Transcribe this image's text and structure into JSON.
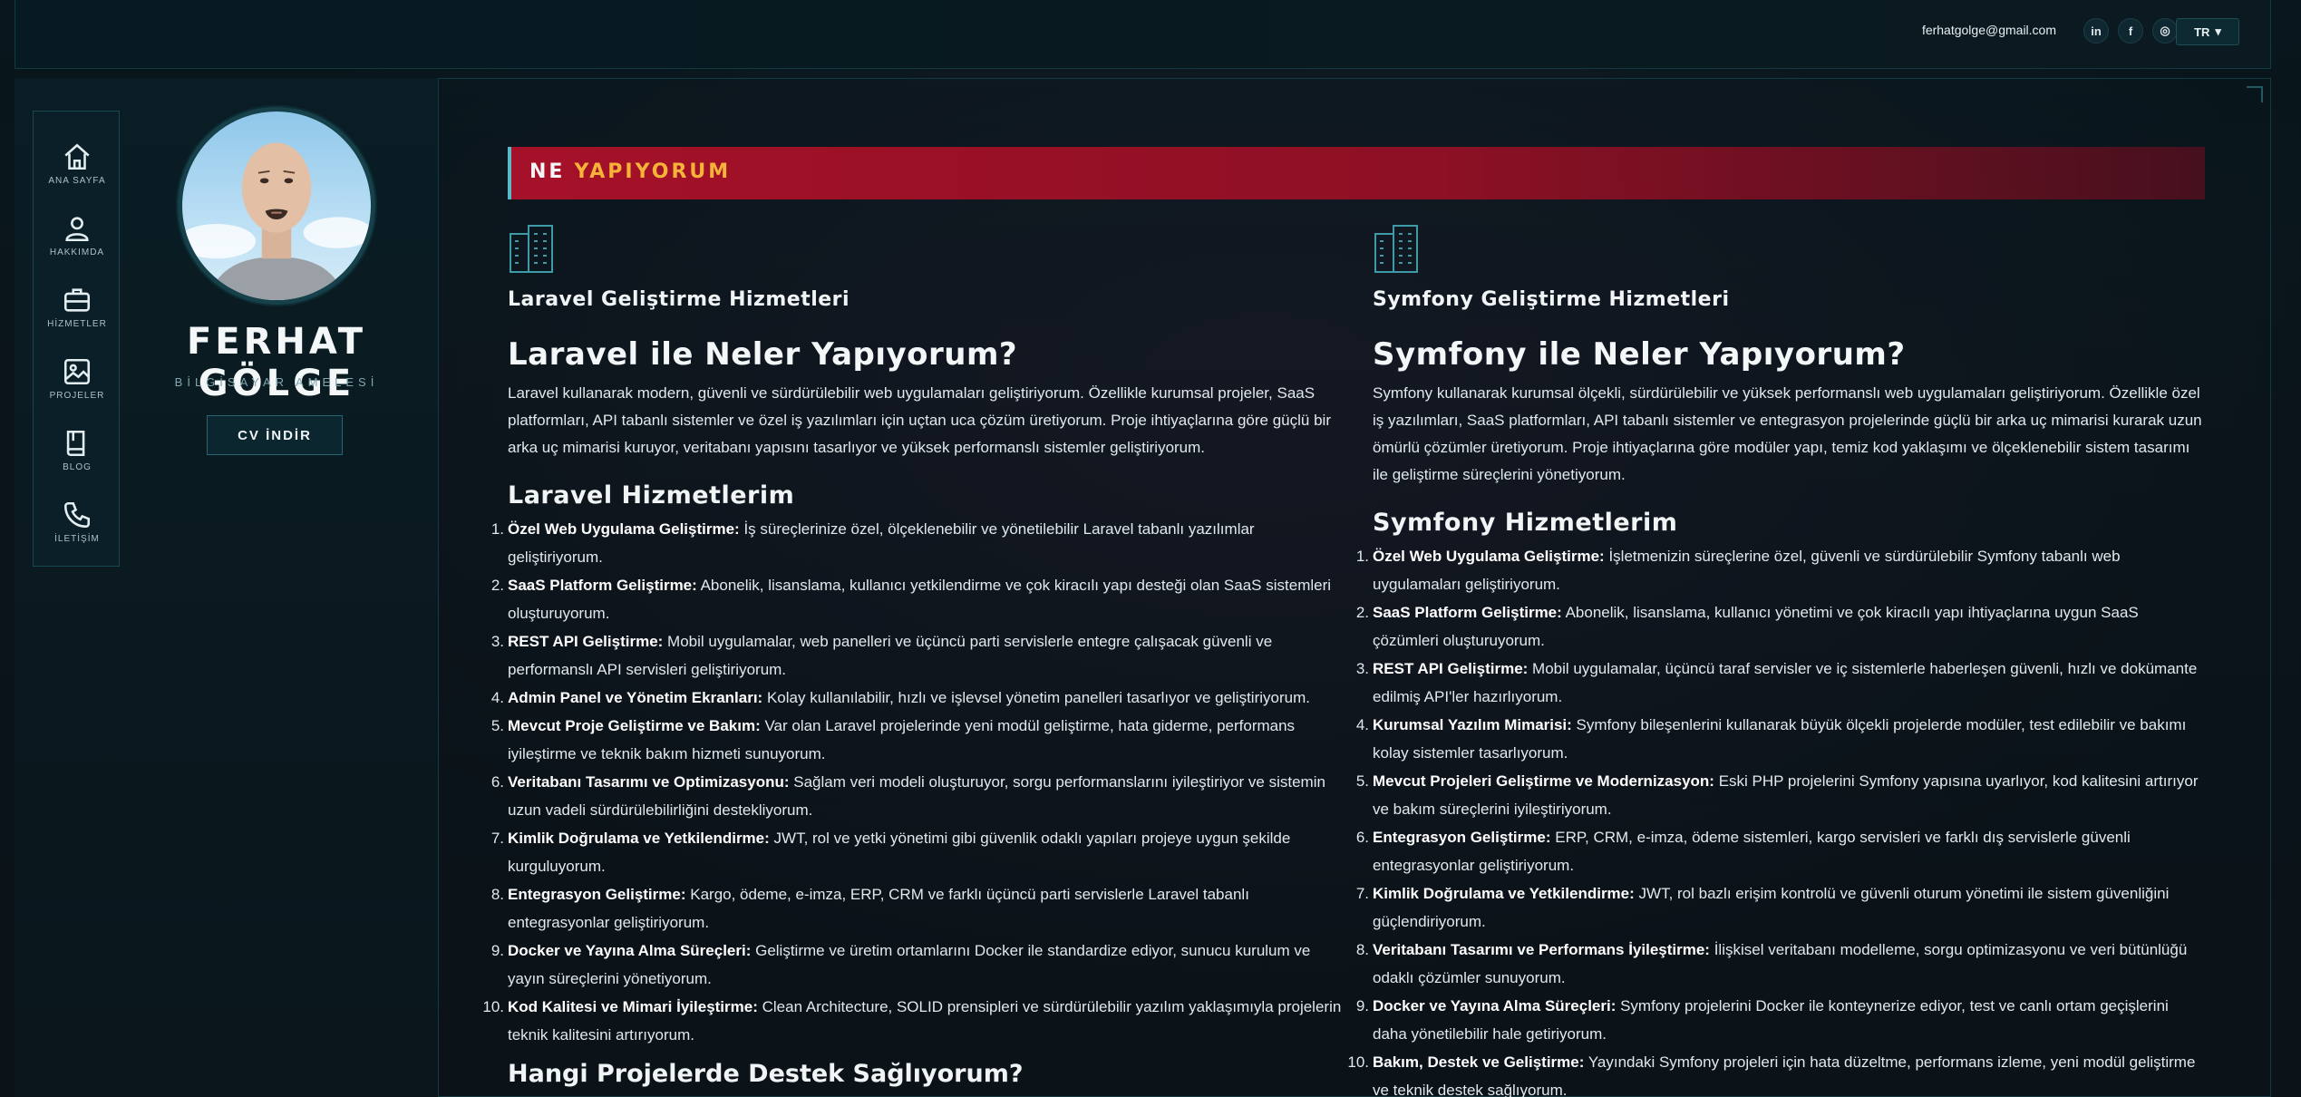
{
  "header": {
    "email": "ferhatgolge@gmail.com",
    "social": [
      {
        "name": "linkedin-icon",
        "glyph": "in"
      },
      {
        "name": "facebook-icon",
        "glyph": "f"
      },
      {
        "name": "instagram-icon",
        "glyph": "◎"
      }
    ],
    "language": "TR"
  },
  "sidebar": {
    "nav": [
      {
        "label": "ANA SAYFA",
        "icon": "home-icon"
      },
      {
        "label": "HAKKIMDA",
        "icon": "user-icon"
      },
      {
        "label": "HİZMETLER",
        "icon": "briefcase-icon"
      },
      {
        "label": "PROJELER",
        "icon": "image-icon"
      },
      {
        "label": "BLOG",
        "icon": "book-icon"
      },
      {
        "label": "İLETİŞİM",
        "icon": "phone-icon"
      }
    ],
    "name": "FERHAT GÖLGE",
    "role": "BİLGİSAYAR AMELESİ",
    "cv_button": "CV İNDİR"
  },
  "banner": {
    "part1": "NE",
    "part2": "YAPIYORUM"
  },
  "left": {
    "service_title": "Laravel Geliştirme Hizmetleri",
    "heading": "Laravel ile Neler Yapıyorum?",
    "intro": "Laravel kullanarak modern, güvenli ve sürdürülebilir web uygulamaları geliştiriyorum. Özellikle kurumsal projeler, SaaS platformları, API tabanlı sistemler ve özel iş yazılımları için uçtan uca çözüm üretiyorum. Proje ihtiyaçlarına göre güçlü bir arka uç mimarisi kuruyor, veritabanı yapısını tasarlıyor ve yüksek performanslı sistemler geliştiriyorum.",
    "list_heading": "Laravel Hizmetlerim",
    "items": [
      {
        "num": "1.",
        "title": "Özel Web Uygulama Geliştirme:",
        "text": " İş süreçlerinize özel, ölçeklenebilir ve yönetilebilir Laravel tabanlı yazılımlar geliştiriyorum."
      },
      {
        "num": "2.",
        "title": "SaaS Platform Geliştirme:",
        "text": " Abonelik, lisanslama, kullanıcı yetkilendirme ve çok kiracılı yapı desteği olan SaaS sistemleri oluşturuyorum."
      },
      {
        "num": "3.",
        "title": "REST API Geliştirme:",
        "text": " Mobil uygulamalar, web panelleri ve üçüncü parti servislerle entegre çalışacak güvenli ve performanslı API servisleri geliştiriyorum."
      },
      {
        "num": "4.",
        "title": "Admin Panel ve Yönetim Ekranları:",
        "text": " Kolay kullanılabilir, hızlı ve işlevsel yönetim panelleri tasarlıyor ve geliştiriyorum."
      },
      {
        "num": "5.",
        "title": "Mevcut Proje Geliştirme ve Bakım:",
        "text": " Var olan Laravel projelerinde yeni modül geliştirme, hata giderme, performans iyileştirme ve teknik bakım hizmeti sunuyorum."
      },
      {
        "num": "6.",
        "title": "Veritabanı Tasarımı ve Optimizasyonu:",
        "text": " Sağlam veri modeli oluşturuyor, sorgu performanslarını iyileştiriyor ve sistemin uzun vadeli sürdürülebilirliğini destekliyorum."
      },
      {
        "num": "7.",
        "title": "Kimlik Doğrulama ve Yetkilendirme:",
        "text": " JWT, rol ve yetki yönetimi gibi güvenlik odaklı yapıları projeye uygun şekilde kurguluyorum."
      },
      {
        "num": "8.",
        "title": "Entegrasyon Geliştirme:",
        "text": " Kargo, ödeme, e-imza, ERP, CRM ve farklı üçüncü parti servislerle Laravel tabanlı entegrasyonlar geliştiriyorum."
      },
      {
        "num": "9.",
        "title": "Docker ve Yayına Alma Süreçleri:",
        "text": " Geliştirme ve üretim ortamlarını Docker ile standardize ediyor, sunucu kurulum ve yayın süreçlerini yönetiyorum."
      },
      {
        "num": "10.",
        "title": "Kod Kalitesi ve Mimari İyileştirme:",
        "text": " Clean Architecture, SOLID prensipleri ve sürdürülebilir yazılım yaklaşımıyla projelerin teknik kalitesini artırıyorum."
      }
    ],
    "next_heading": "Hangi Projelerde Destek Sağlıyorum?"
  },
  "right": {
    "service_title": "Symfony Geliştirme Hizmetleri",
    "heading": "Symfony ile Neler Yapıyorum?",
    "intro": "Symfony kullanarak kurumsal ölçekli, sürdürülebilir ve yüksek performanslı web uygulamaları geliştiriyorum. Özellikle özel iş yazılımları, SaaS platformları, API tabanlı sistemler ve entegrasyon projelerinde güçlü bir arka uç mimarisi kurarak uzun ömürlü çözümler üretiyorum. Proje ihtiyaçlarına göre modüler yapı, temiz kod yaklaşımı ve ölçeklenebilir sistem tasarımı ile geliştirme süreçlerini yönetiyorum.",
    "list_heading": "Symfony Hizmetlerim",
    "items": [
      {
        "num": "1.",
        "title": "Özel Web Uygulama Geliştirme:",
        "text": " İşletmenizin süreçlerine özel, güvenli ve sürdürülebilir Symfony tabanlı web uygulamaları geliştiriyorum."
      },
      {
        "num": "2.",
        "title": "SaaS Platform Geliştirme:",
        "text": " Abonelik, lisanslama, kullanıcı yönetimi ve çok kiracılı yapı ihtiyaçlarına uygun SaaS çözümleri oluşturuyorum."
      },
      {
        "num": "3.",
        "title": "REST API Geliştirme:",
        "text": " Mobil uygulamalar, üçüncü taraf servisler ve iç sistemlerle haberleşen güvenli, hızlı ve dokümante edilmiş API'ler hazırlıyorum."
      },
      {
        "num": "4.",
        "title": "Kurumsal Yazılım Mimarisi:",
        "text": " Symfony bileşenlerini kullanarak büyük ölçekli projelerde modüler, test edilebilir ve bakımı kolay sistemler tasarlıyorum."
      },
      {
        "num": "5.",
        "title": "Mevcut Projeleri Geliştirme ve Modernizasyon:",
        "text": " Eski PHP projelerini Symfony yapısına uyarlıyor, kod kalitesini artırıyor ve bakım süreçlerini iyileştiriyorum."
      },
      {
        "num": "6.",
        "title": "Entegrasyon Geliştirme:",
        "text": " ERP, CRM, e-imza, ödeme sistemleri, kargo servisleri ve farklı dış servislerle güvenli entegrasyonlar geliştiriyorum."
      },
      {
        "num": "7.",
        "title": "Kimlik Doğrulama ve Yetkilendirme:",
        "text": " JWT, rol bazlı erişim kontrolü ve güvenli oturum yönetimi ile sistem güvenliğini güçlendiriyorum."
      },
      {
        "num": "8.",
        "title": "Veritabanı Tasarımı ve Performans İyileştirme:",
        "text": " İlişkisel veritabanı modelleme, sorgu optimizasyonu ve veri bütünlüğü odaklı çözümler sunuyorum."
      },
      {
        "num": "9.",
        "title": "Docker ve Yayına Alma Süreçleri:",
        "text": " Symfony projelerini Docker ile konteynerize ediyor, test ve canlı ortam geçişlerini daha yönetilebilir hale getiriyorum."
      },
      {
        "num": "10.",
        "title": "Bakım, Destek ve Geliştirme:",
        "text": " Yayındaki Symfony projeleri için hata düzeltme, performans izleme, yeni modül geliştirme ve teknik destek sağlıyorum."
      }
    ]
  }
}
